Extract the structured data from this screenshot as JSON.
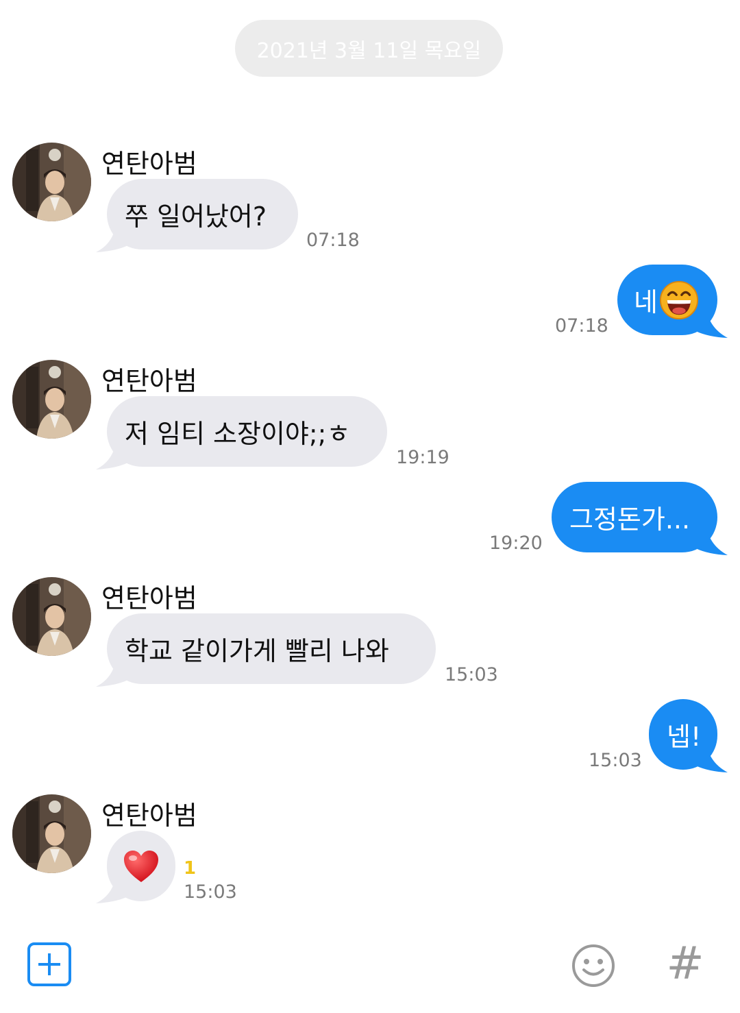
{
  "date_divider": "2021년 3월 11일 목요일",
  "contact": {
    "name": "연탄아범"
  },
  "messages": [
    {
      "from": "contact",
      "sender": "연탄아범",
      "text": "쭈 일어났어?",
      "time": "07:18"
    },
    {
      "from": "me",
      "text": "네",
      "emoji": "grinning-face-emoji",
      "time": "07:18"
    },
    {
      "from": "contact",
      "sender": "연탄아범",
      "text": "저 임티 소장이야;;ㅎ",
      "time": "19:19"
    },
    {
      "from": "me",
      "text": "그정돈가...",
      "time": "19:20"
    },
    {
      "from": "contact",
      "sender": "연탄아범",
      "text": "학교 같이가게 빨리 나와",
      "time": "15:03"
    },
    {
      "from": "me",
      "text": "넵!",
      "time": "15:03"
    },
    {
      "from": "contact",
      "sender": "연탄아범",
      "emoji": "red-heart-emoji",
      "unread": "1",
      "time": "15:03"
    }
  ],
  "toolbar": {
    "attach_icon": "plus-icon",
    "emoji_icon": "smiley-icon",
    "hashtag_icon": "hashtag-icon",
    "hashtag_glyph": "#"
  },
  "colors": {
    "outgoing_bubble": "#1a8cf3",
    "incoming_bubble": "#e9e9ee",
    "unread_badge": "#f0c419"
  }
}
